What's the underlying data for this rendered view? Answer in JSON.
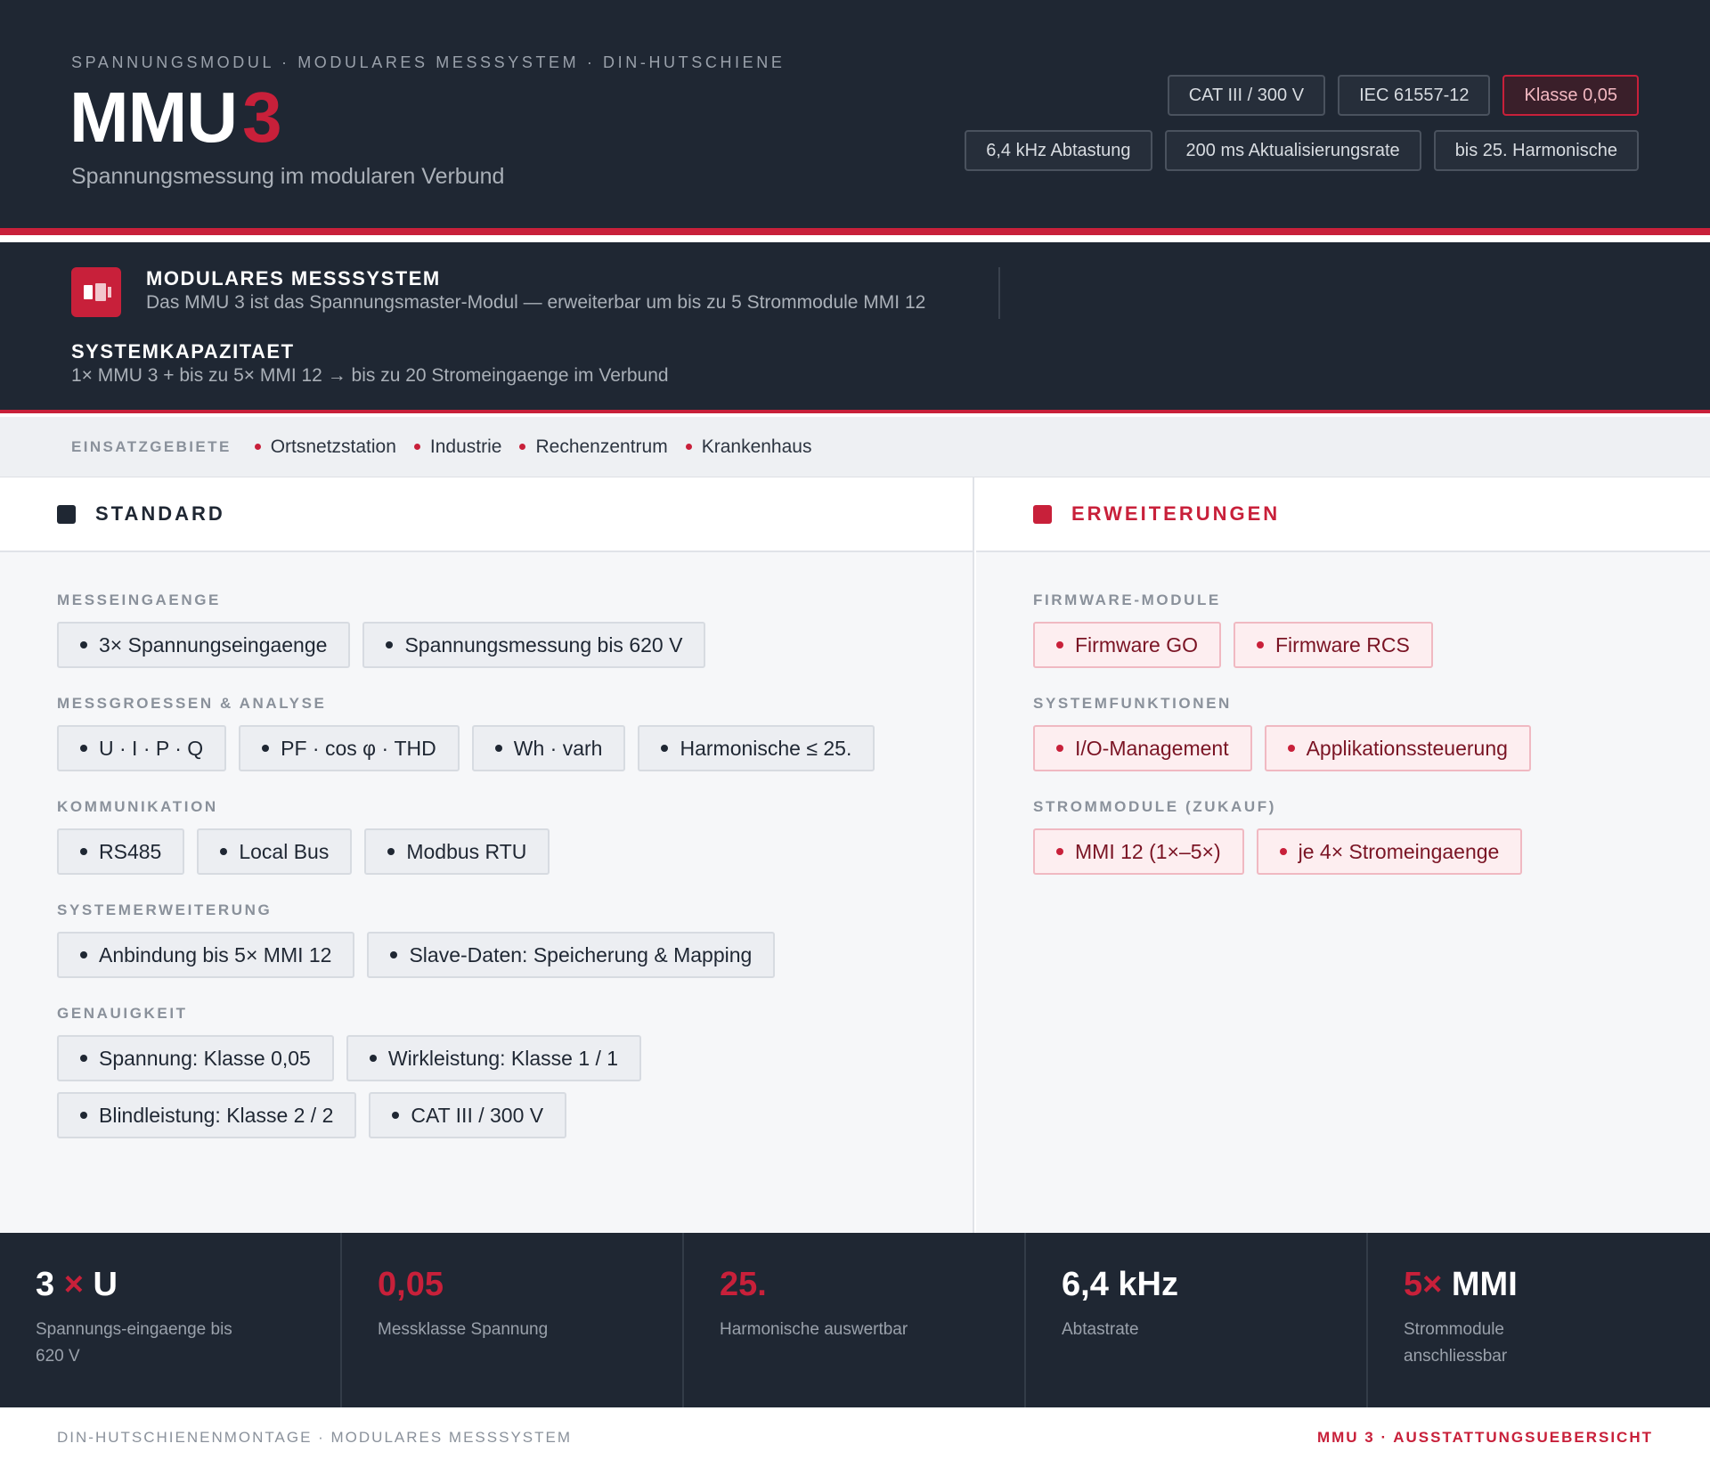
{
  "header": {
    "eyebrow": "SPANNUNGSMODUL · MODULARES MESSSYSTEM · DIN-HUTSCHIENE",
    "title_main": "MMU",
    "title_number": "3",
    "subtitle": "Spannungsmessung im modularen Verbund",
    "badges_row1": [
      "CAT III / 300 V",
      "IEC 61557-12",
      "Klasse 0,05"
    ],
    "badges_row2": [
      "6,4 kHz Abtastung",
      "200 ms Aktualisierungsrate",
      "bis 25. Harmonische"
    ]
  },
  "system": {
    "title": "MODULARES MESSSYSTEM",
    "text": "Das MMU 3 ist das Spannungsmaster-Modul — erweiterbar um bis zu 5 Strommodule MMI 12",
    "capacity_title": "SYSTEMKAPAZITAET",
    "capacity_text": "1× MMU 3 + bis zu 5× MMI 12 → bis zu 20 Stromeingaenge im Verbund"
  },
  "areas": {
    "label": "EINSATZGEBIETE",
    "items": [
      "Ortsnetzstation",
      "Industrie",
      "Rechenzentrum",
      "Krankenhaus"
    ]
  },
  "standard": {
    "heading": "STANDARD",
    "groups": [
      {
        "label": "MESSEINGAENGE",
        "items": [
          "3× Spannungseingaenge",
          "Spannungsmessung bis 620 V"
        ]
      },
      {
        "label": "MESSGROESSEN & ANALYSE",
        "items": [
          "U · I · P · Q",
          "PF · cos φ · THD",
          "Wh · varh",
          "Harmonische ≤ 25."
        ]
      },
      {
        "label": "KOMMUNIKATION",
        "items": [
          "RS485",
          "Local Bus",
          "Modbus RTU"
        ]
      },
      {
        "label": "SYSTEMERWEITERUNG",
        "items": [
          "Anbindung bis 5× MMI 12",
          "Slave-Daten: Speicherung & Mapping"
        ]
      },
      {
        "label": "GENAUIGKEIT",
        "items": [
          "Spannung: Klasse 0,05",
          "Wirkleistung: Klasse 1 / 1",
          "Blindleistung: Klasse 2 / 2",
          "CAT III / 300 V"
        ]
      }
    ]
  },
  "extensions": {
    "heading": "ERWEITERUNGEN",
    "groups": [
      {
        "label": "FIRMWARE-MODULE",
        "items": [
          "Firmware GO",
          "Firmware RCS"
        ]
      },
      {
        "label": "SYSTEMFUNKTIONEN",
        "items": [
          "I/O-Management",
          "Applikationssteuerung"
        ]
      },
      {
        "label": "STROMMODULE (ZUKAUF)",
        "items": [
          "MMI 12 (1×–5×)",
          "je 4× Stromeingaenge"
        ]
      }
    ]
  },
  "stats": [
    {
      "val_a": "3",
      "val_b": "×",
      "val_c": "U",
      "label": "Spannungs-eingaenge bis 620 V"
    },
    {
      "val_a": "",
      "val_b": "0,05",
      "val_c": "",
      "label": "Messklasse Spannung"
    },
    {
      "val_a": "",
      "val_b": "25.",
      "val_c": "",
      "label": "Harmonische auswertbar"
    },
    {
      "val_a": "6,4 kHz",
      "val_b": "",
      "val_c": "",
      "label": "Abtastrate"
    },
    {
      "val_a": "",
      "val_b": "5×",
      "val_c": "MMI",
      "label": "Strommodule anschliessbar"
    }
  ],
  "footer": {
    "left": "DIN-HUTSCHIENENMONTAGE · MODULARES MESSSYSTEM",
    "right": "MMU 3 · AUSSTATTUNGSUEBERSICHT"
  },
  "colors": {
    "accent": "#c8203a",
    "dark": "#1f2733",
    "panel": "#f6f7f9"
  }
}
